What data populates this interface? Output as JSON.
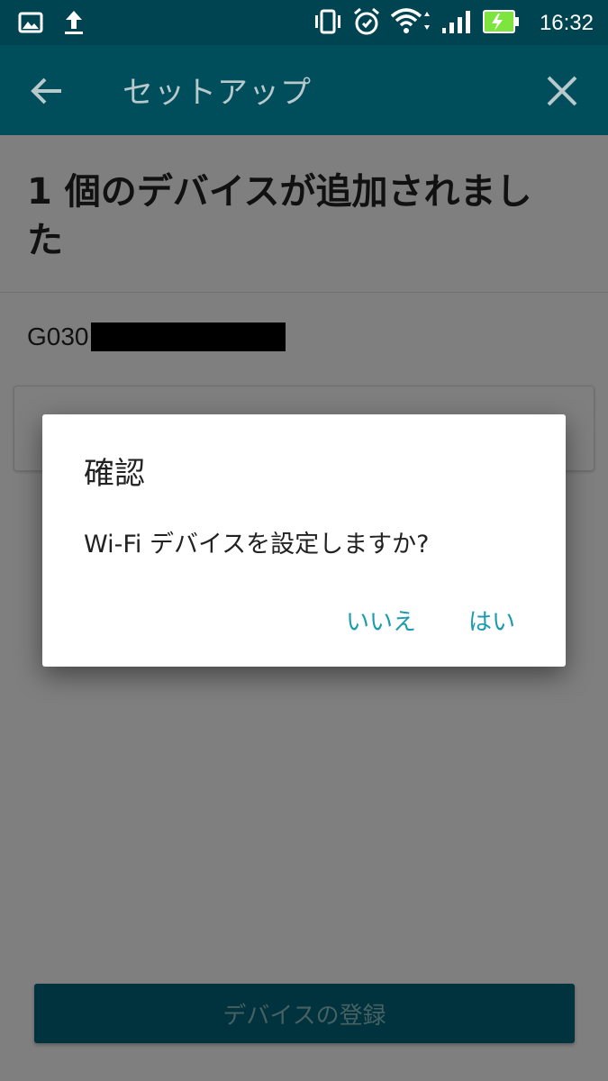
{
  "status_bar": {
    "time": "16:32",
    "left_icons": [
      "gallery-icon",
      "upload-icon"
    ],
    "right_icons": [
      "vibrate-icon",
      "alarm-icon",
      "wifi-icon",
      "signal-icon",
      "battery-charging-icon"
    ]
  },
  "app_bar": {
    "title": "セットアップ",
    "back_icon": "arrow-back-icon",
    "close_icon": "close-icon"
  },
  "content": {
    "headline": "1 個のデバイスが追加されました",
    "device_id_prefix": "G030",
    "register_button": "デバイスの登録"
  },
  "dialog": {
    "title": "確認",
    "message": "Wi-Fi デバイスを設定しますか?",
    "negative_button": "いいえ",
    "positive_button": "はい"
  },
  "colors": {
    "app_bar": "#004d5b",
    "accent": "#1a9bb0",
    "register_button": "#00667a"
  }
}
